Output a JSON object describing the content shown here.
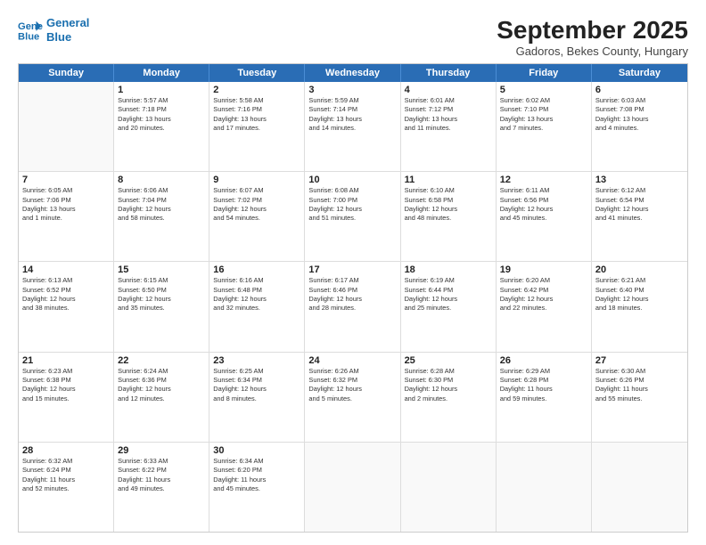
{
  "header": {
    "logo_line1": "General",
    "logo_line2": "Blue",
    "title": "September 2025",
    "subtitle": "Gadoros, Bekes County, Hungary"
  },
  "days_of_week": [
    "Sunday",
    "Monday",
    "Tuesday",
    "Wednesday",
    "Thursday",
    "Friday",
    "Saturday"
  ],
  "weeks": [
    [
      {
        "day": "",
        "info": ""
      },
      {
        "day": "1",
        "info": "Sunrise: 5:57 AM\nSunset: 7:18 PM\nDaylight: 13 hours\nand 20 minutes."
      },
      {
        "day": "2",
        "info": "Sunrise: 5:58 AM\nSunset: 7:16 PM\nDaylight: 13 hours\nand 17 minutes."
      },
      {
        "day": "3",
        "info": "Sunrise: 5:59 AM\nSunset: 7:14 PM\nDaylight: 13 hours\nand 14 minutes."
      },
      {
        "day": "4",
        "info": "Sunrise: 6:01 AM\nSunset: 7:12 PM\nDaylight: 13 hours\nand 11 minutes."
      },
      {
        "day": "5",
        "info": "Sunrise: 6:02 AM\nSunset: 7:10 PM\nDaylight: 13 hours\nand 7 minutes."
      },
      {
        "day": "6",
        "info": "Sunrise: 6:03 AM\nSunset: 7:08 PM\nDaylight: 13 hours\nand 4 minutes."
      }
    ],
    [
      {
        "day": "7",
        "info": "Sunrise: 6:05 AM\nSunset: 7:06 PM\nDaylight: 13 hours\nand 1 minute."
      },
      {
        "day": "8",
        "info": "Sunrise: 6:06 AM\nSunset: 7:04 PM\nDaylight: 12 hours\nand 58 minutes."
      },
      {
        "day": "9",
        "info": "Sunrise: 6:07 AM\nSunset: 7:02 PM\nDaylight: 12 hours\nand 54 minutes."
      },
      {
        "day": "10",
        "info": "Sunrise: 6:08 AM\nSunset: 7:00 PM\nDaylight: 12 hours\nand 51 minutes."
      },
      {
        "day": "11",
        "info": "Sunrise: 6:10 AM\nSunset: 6:58 PM\nDaylight: 12 hours\nand 48 minutes."
      },
      {
        "day": "12",
        "info": "Sunrise: 6:11 AM\nSunset: 6:56 PM\nDaylight: 12 hours\nand 45 minutes."
      },
      {
        "day": "13",
        "info": "Sunrise: 6:12 AM\nSunset: 6:54 PM\nDaylight: 12 hours\nand 41 minutes."
      }
    ],
    [
      {
        "day": "14",
        "info": "Sunrise: 6:13 AM\nSunset: 6:52 PM\nDaylight: 12 hours\nand 38 minutes."
      },
      {
        "day": "15",
        "info": "Sunrise: 6:15 AM\nSunset: 6:50 PM\nDaylight: 12 hours\nand 35 minutes."
      },
      {
        "day": "16",
        "info": "Sunrise: 6:16 AM\nSunset: 6:48 PM\nDaylight: 12 hours\nand 32 minutes."
      },
      {
        "day": "17",
        "info": "Sunrise: 6:17 AM\nSunset: 6:46 PM\nDaylight: 12 hours\nand 28 minutes."
      },
      {
        "day": "18",
        "info": "Sunrise: 6:19 AM\nSunset: 6:44 PM\nDaylight: 12 hours\nand 25 minutes."
      },
      {
        "day": "19",
        "info": "Sunrise: 6:20 AM\nSunset: 6:42 PM\nDaylight: 12 hours\nand 22 minutes."
      },
      {
        "day": "20",
        "info": "Sunrise: 6:21 AM\nSunset: 6:40 PM\nDaylight: 12 hours\nand 18 minutes."
      }
    ],
    [
      {
        "day": "21",
        "info": "Sunrise: 6:23 AM\nSunset: 6:38 PM\nDaylight: 12 hours\nand 15 minutes."
      },
      {
        "day": "22",
        "info": "Sunrise: 6:24 AM\nSunset: 6:36 PM\nDaylight: 12 hours\nand 12 minutes."
      },
      {
        "day": "23",
        "info": "Sunrise: 6:25 AM\nSunset: 6:34 PM\nDaylight: 12 hours\nand 8 minutes."
      },
      {
        "day": "24",
        "info": "Sunrise: 6:26 AM\nSunset: 6:32 PM\nDaylight: 12 hours\nand 5 minutes."
      },
      {
        "day": "25",
        "info": "Sunrise: 6:28 AM\nSunset: 6:30 PM\nDaylight: 12 hours\nand 2 minutes."
      },
      {
        "day": "26",
        "info": "Sunrise: 6:29 AM\nSunset: 6:28 PM\nDaylight: 11 hours\nand 59 minutes."
      },
      {
        "day": "27",
        "info": "Sunrise: 6:30 AM\nSunset: 6:26 PM\nDaylight: 11 hours\nand 55 minutes."
      }
    ],
    [
      {
        "day": "28",
        "info": "Sunrise: 6:32 AM\nSunset: 6:24 PM\nDaylight: 11 hours\nand 52 minutes."
      },
      {
        "day": "29",
        "info": "Sunrise: 6:33 AM\nSunset: 6:22 PM\nDaylight: 11 hours\nand 49 minutes."
      },
      {
        "day": "30",
        "info": "Sunrise: 6:34 AM\nSunset: 6:20 PM\nDaylight: 11 hours\nand 45 minutes."
      },
      {
        "day": "",
        "info": ""
      },
      {
        "day": "",
        "info": ""
      },
      {
        "day": "",
        "info": ""
      },
      {
        "day": "",
        "info": ""
      }
    ]
  ]
}
